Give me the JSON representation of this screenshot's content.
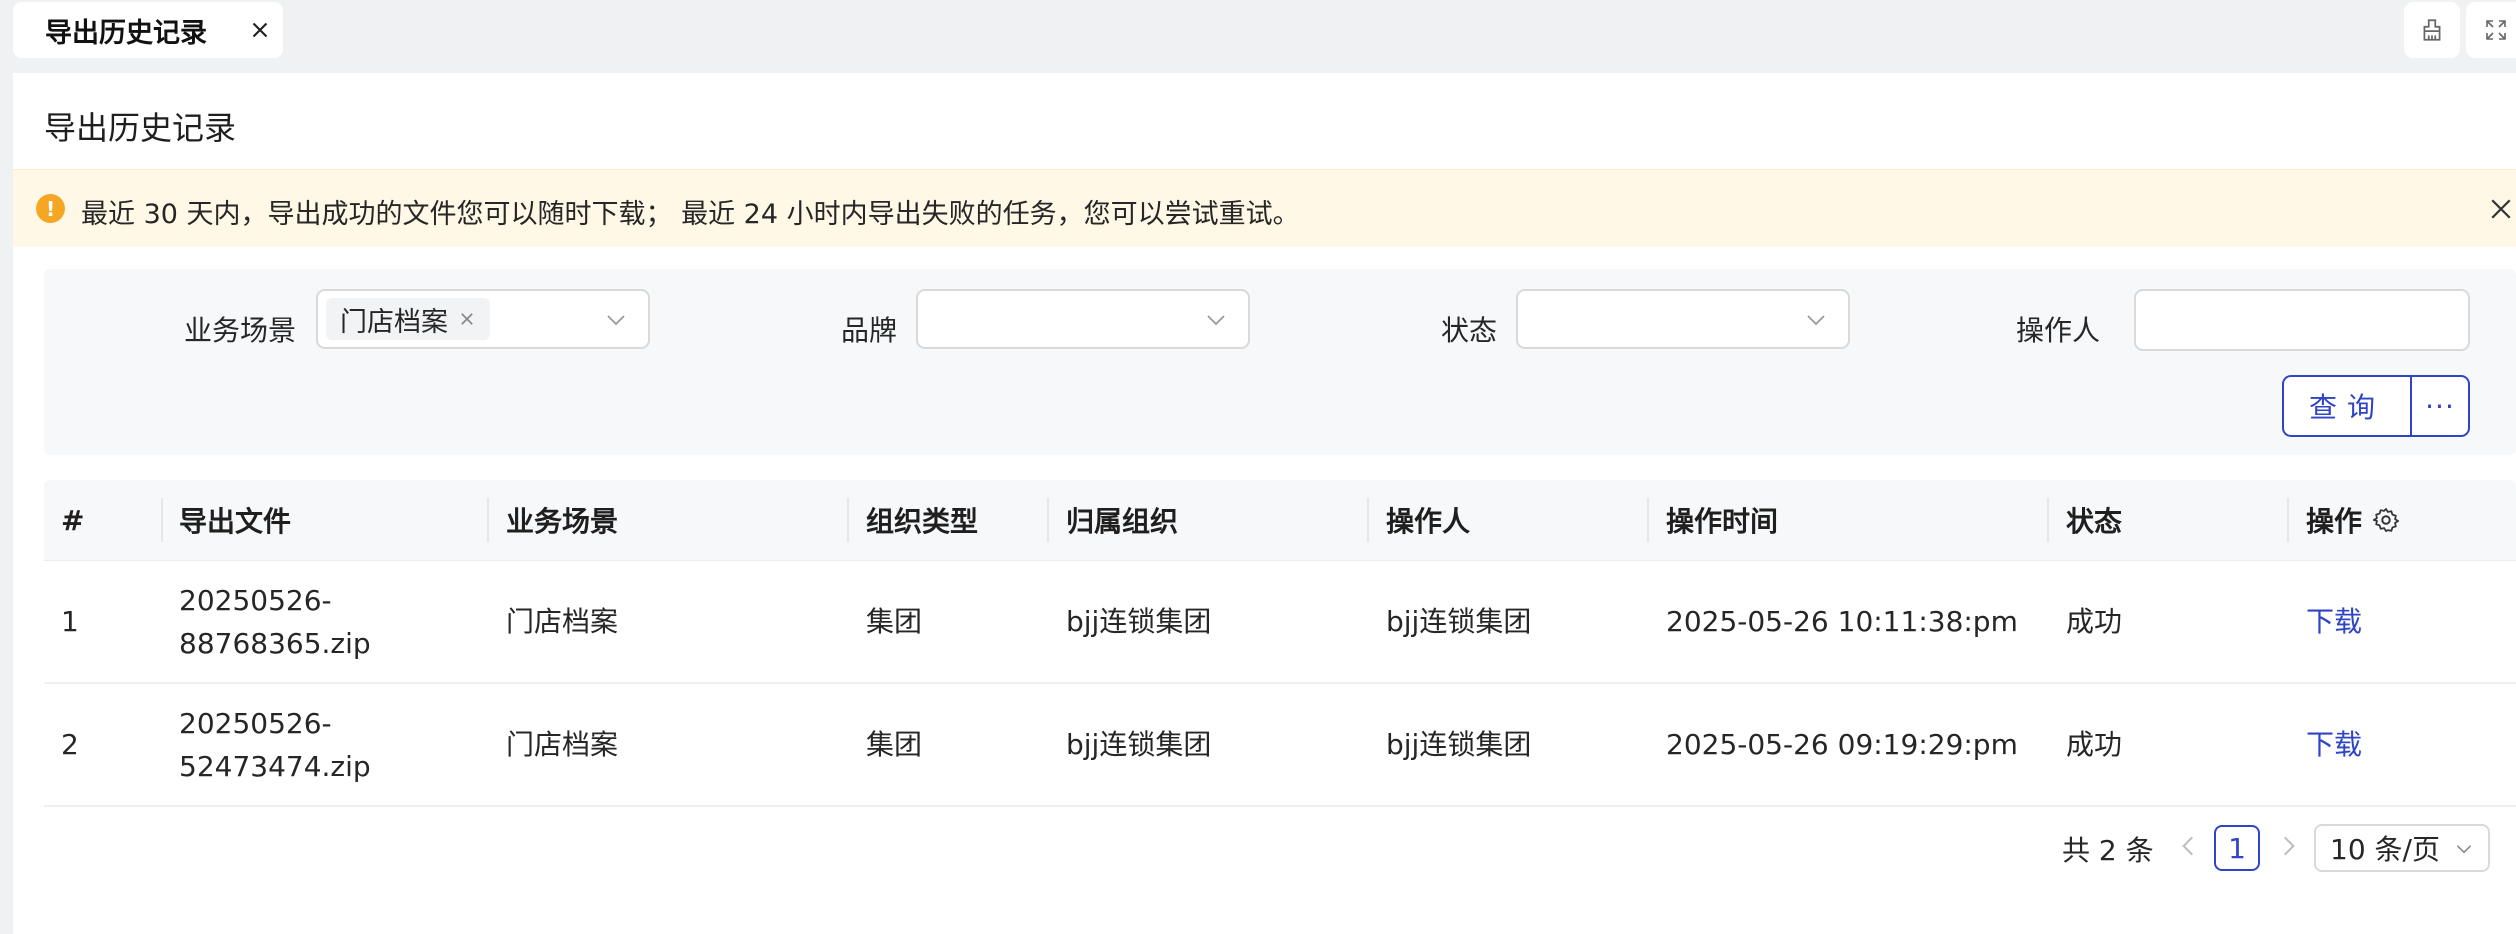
{
  "tab": {
    "label": "导出历史记录"
  },
  "page": {
    "title": "导出历史记录"
  },
  "alert": {
    "icon": "warning-circle-icon",
    "text": "最近 30 天内，导出成功的文件您可以随时下载； 最近 24 小时内导出失败的任务，您可以尝试重试。"
  },
  "filters": {
    "scene_label": "业务场景",
    "scene_tag": "门店档案",
    "brand_label": "品牌",
    "status_label": "状态",
    "operator_label": "操作人",
    "query_button": "查询",
    "more_button": "···"
  },
  "table": {
    "columns": [
      "#",
      "导出文件",
      "业务场景",
      "组织类型",
      "归属组织",
      "操作人",
      "操作时间",
      "状态",
      "操作"
    ],
    "rows": [
      {
        "index": "1",
        "file": "20250526-88768365.zip",
        "scene": "门店档案",
        "org_type": "集团",
        "org": "bjj连锁集团",
        "operator": "bjj连锁集团",
        "time": "2025-05-26 10:11:38:pm",
        "status": "成功",
        "action": "下载"
      },
      {
        "index": "2",
        "file": "20250526-52473474.zip",
        "scene": "门店档案",
        "org_type": "集团",
        "org": "bjj连锁集团",
        "operator": "bjj连锁集团",
        "time": "2025-05-26 09:19:29:pm",
        "status": "成功",
        "action": "下载"
      }
    ]
  },
  "pagination": {
    "total": "共 2 条",
    "current_page": "1",
    "page_size": "10 条/页"
  },
  "colors": {
    "accent": "#2f45c5",
    "alert_bg": "#fff8e6",
    "warning": "#f5a623"
  }
}
